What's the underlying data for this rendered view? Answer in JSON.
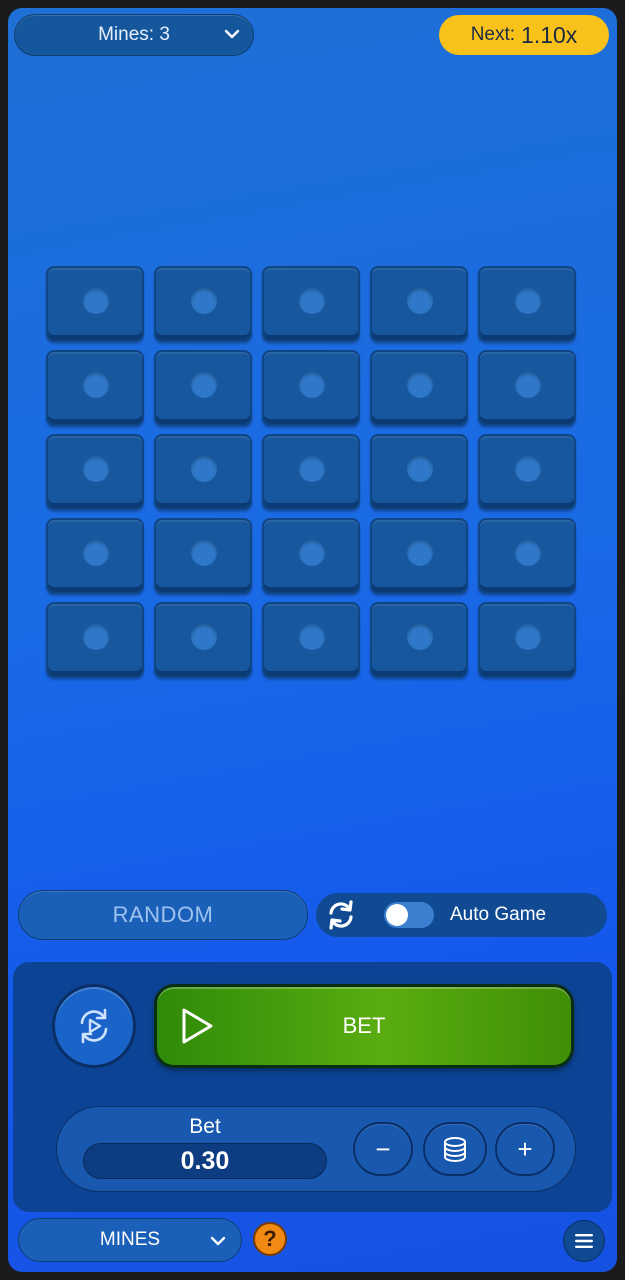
{
  "header": {
    "mines_label": "Mines: 3",
    "next_label": "Next:",
    "next_multiplier": "1.10x"
  },
  "grid": {
    "rows": 5,
    "cols": 5
  },
  "actions": {
    "random_label": "RANDOM",
    "auto_game_label": "Auto Game",
    "auto_game_enabled": false
  },
  "bet_controls": {
    "bet_button_label": "BET",
    "bet_title": "Bet",
    "bet_value": "0.30",
    "minus_label": "−",
    "plus_label": "+"
  },
  "footer": {
    "game_select_label": "MINES",
    "help_label": "?"
  },
  "colors": {
    "accent_yellow": "#f8c21a",
    "bet_green": "#5aad10",
    "help_orange": "#f08a12"
  }
}
